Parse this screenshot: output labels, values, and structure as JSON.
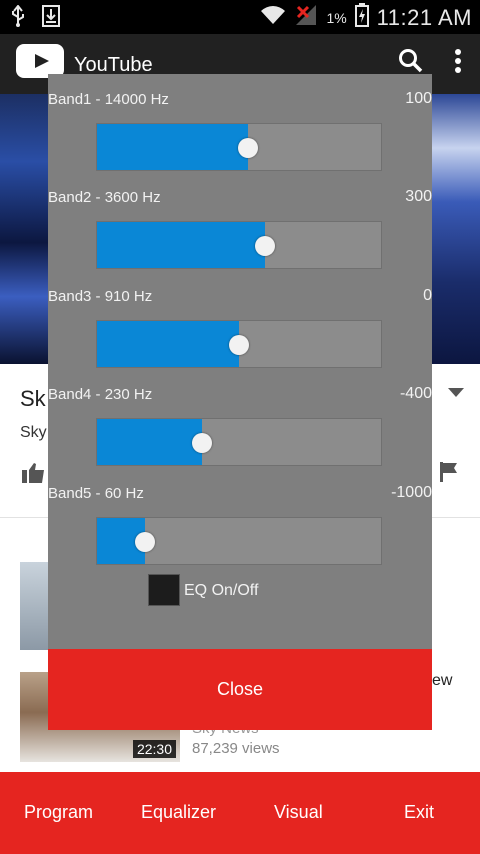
{
  "status_bar": {
    "time": "11:21 AM",
    "battery_percent": "1%",
    "icons": [
      "usb-icon",
      "download-icon",
      "wifi-icon",
      "no-signal-icon",
      "battery-charging-icon"
    ]
  },
  "app_bar": {
    "title": "YouTube",
    "icons": [
      "youtube-logo",
      "search-icon",
      "overflow-menu-icon"
    ]
  },
  "background_content": {
    "title_peek": "Sk",
    "channel_peek": "Sky",
    "peek_right": "ew",
    "video_duration": "22:30",
    "video_channel": "Sky News",
    "video_views": "87,239 views"
  },
  "equalizer_dialog": {
    "bands": [
      {
        "label": "Band1 - 14000 Hz",
        "value": "100",
        "level": 0.53
      },
      {
        "label": "Band2 - 3600 Hz",
        "value": "300",
        "level": 0.59
      },
      {
        "label": "Band3 - 910 Hz",
        "value": "0",
        "level": 0.5
      },
      {
        "label": "Band4 - 230 Hz",
        "value": "-400",
        "level": 0.37
      },
      {
        "label": "Band5 - 60 Hz",
        "value": "-1000",
        "level": 0.17
      }
    ],
    "eq_toggle_label": "EQ On/Off",
    "eq_enabled": false,
    "close_label": "Close",
    "fill_color": "#0a87d6"
  },
  "bottom_bar": {
    "items": [
      "Program",
      "Equalizer",
      "Visual",
      "Exit"
    ],
    "color": "#e52520"
  }
}
